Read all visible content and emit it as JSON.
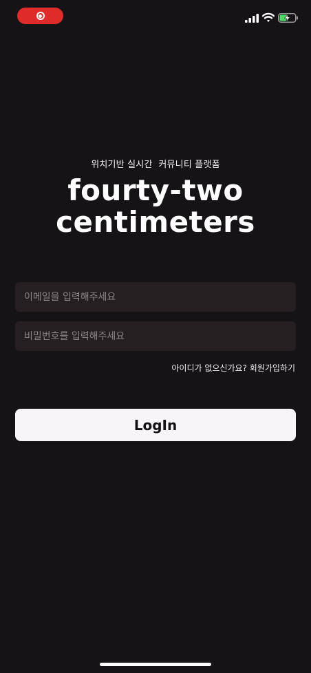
{
  "status_bar": {
    "signal_icon": "cellular-signal-icon",
    "wifi_icon": "wifi-icon",
    "battery_icon": "battery-charging-icon",
    "recording_color": "#e02b2b",
    "battery_color": "#4cd964"
  },
  "hero": {
    "tagline": "위치기반 실시간  커뮤니티 플랫폼",
    "logo_line1": "fourty-two",
    "logo_line2": "centimeters"
  },
  "form": {
    "email_placeholder": "이메일을 입력해주세요",
    "email_value": "",
    "password_placeholder": "비밀번호를 입력해주세요",
    "password_value": "",
    "signup_text": "아이디가 없으신가요? 회원가입하기",
    "login_label": "LogIn"
  },
  "theme": {
    "background": "#161316",
    "input_background": "#251f22",
    "button_background": "#f8f5f8"
  }
}
